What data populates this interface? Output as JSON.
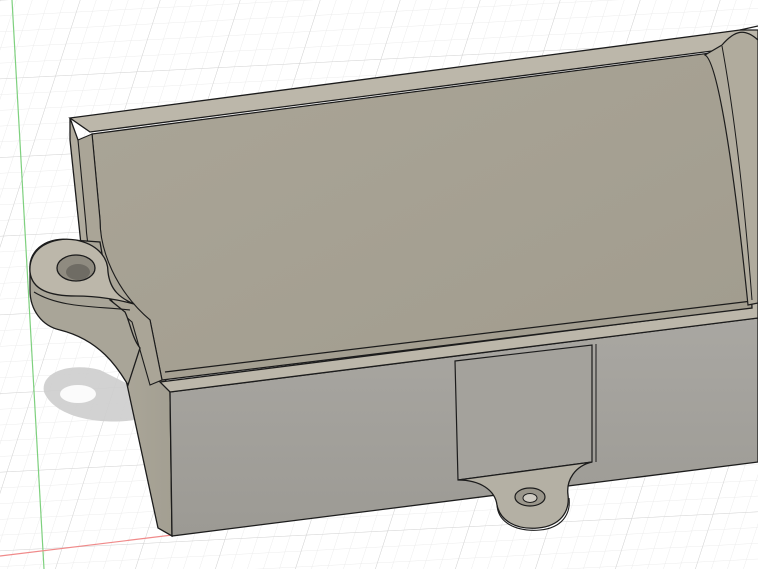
{
  "viewport": {
    "background_color": "#ffffff",
    "grid_minor_color": "#ebebeb",
    "grid_major_color": "#d2d2d2",
    "axis_y_color": "#7ed07e",
    "axis_x_color": "#f08a8a"
  },
  "model": {
    "top_face_color": "#b4ae9f",
    "floor_color": "#a7a293",
    "side_face_color": "#a8a49a",
    "front_face_color": "#a2a09a",
    "rim_color": "#bcb7aa",
    "edge_color": "#1c1c1c",
    "shadow_color": "#cdcdcd"
  },
  "icons": {
    "grid": "ground-grid-icon",
    "model": "enclosure-box-icon",
    "left_tab": "mounting-tab-icon",
    "front_tab": "mounting-tab-icon",
    "hole": "screw-hole-icon"
  }
}
